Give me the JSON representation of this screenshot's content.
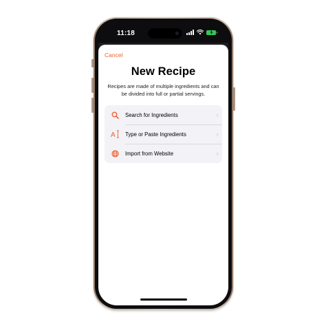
{
  "status_bar": {
    "time": "11:18"
  },
  "sheet": {
    "cancel_label": "Cancel",
    "title": "New Recipe",
    "subtitle": "Recipes are made of multiple ingredients and can be divided into full or partial servings.",
    "options": [
      {
        "label": "Search for Ingredients",
        "icon": "magnifying-glass-icon"
      },
      {
        "label": "Type or Paste Ingredients",
        "icon": "text-cursor-icon"
      },
      {
        "label": "Import from Website",
        "icon": "globe-icon"
      }
    ]
  },
  "colors": {
    "accent": "#f06232",
    "card_background": "#f2f2f7",
    "battery": "#34c759"
  }
}
